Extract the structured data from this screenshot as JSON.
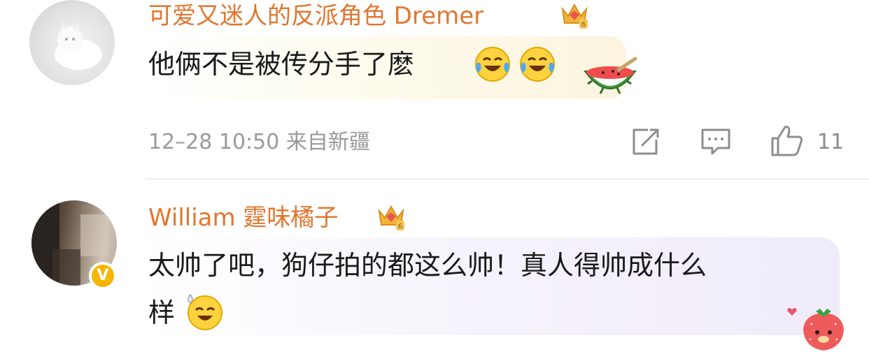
{
  "comments": [
    {
      "username": "可爱又迷人的反派角色 Dremer",
      "text": "他俩不是被传分手了麽",
      "meta": "12–28 10:50 来自新疆",
      "likes": "11",
      "emojis": [
        "laugh-cry-emoji",
        "laugh-cry-emoji"
      ],
      "sticker": "watermelon-sticker"
    },
    {
      "username": "William 霆味橘子",
      "text_line1": "太帅了吧，狗仔拍的都这么帅！真人得帅成什么",
      "text_line2": "样",
      "emojis": [
        "happy-sweat-emoji"
      ],
      "sticker": "strawberry-sticker",
      "verified": true
    }
  ],
  "colors": {
    "username": "#e2762e",
    "meta": "#9a9a9a",
    "verified_badge": "#f7b500"
  }
}
